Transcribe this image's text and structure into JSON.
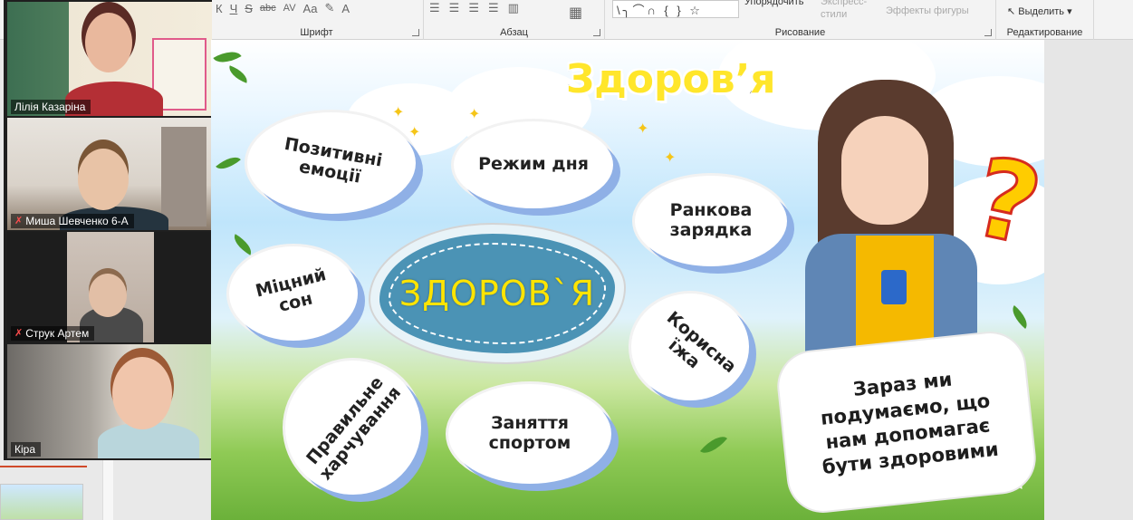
{
  "ribbon": {
    "groups": [
      {
        "name": "font",
        "caption": "Шрифт"
      },
      {
        "name": "paragraph",
        "caption": "Абзац"
      },
      {
        "name": "drawing",
        "caption": "Рисование"
      },
      {
        "name": "editing",
        "caption": "Редактирование"
      }
    ],
    "font_tools": [
      "К",
      "Ч",
      "S",
      "abc",
      "AV",
      "Aa",
      "A"
    ],
    "arrange_label": "Упорядочить",
    "express_styles_label": "Экспресс-",
    "express_styles_label2": "стили",
    "shape_effects_label": "Эффекты фигуры",
    "select_label": "Выделить",
    "shapes_glyphs": "\\╮⌒∩ { } ☆"
  },
  "participants": [
    {
      "name": "Лілія Казаріна",
      "muted": false,
      "active": true
    },
    {
      "name": "Миша Шевченко 6-А",
      "muted": true,
      "active": false
    },
    {
      "name": "Струк Артем",
      "muted": true,
      "active": false
    },
    {
      "name": "Кіра",
      "muted": false,
      "active": false
    }
  ],
  "slide": {
    "title": "Здоров’я",
    "center": "ЗДОРОВ`Я",
    "bubbles": {
      "positive": "Позитивні емоції",
      "routine": "Режим дня",
      "exercise": "Ранкова зарядка",
      "sleep": "Міцний сон",
      "food": "Корисна їжа",
      "nutrition": "Правильне харчування",
      "sport": "Заняття спортом"
    },
    "speech": "Зараз ми подумаємо, що нам допомагає бути здоровими",
    "question_mark": "?"
  }
}
